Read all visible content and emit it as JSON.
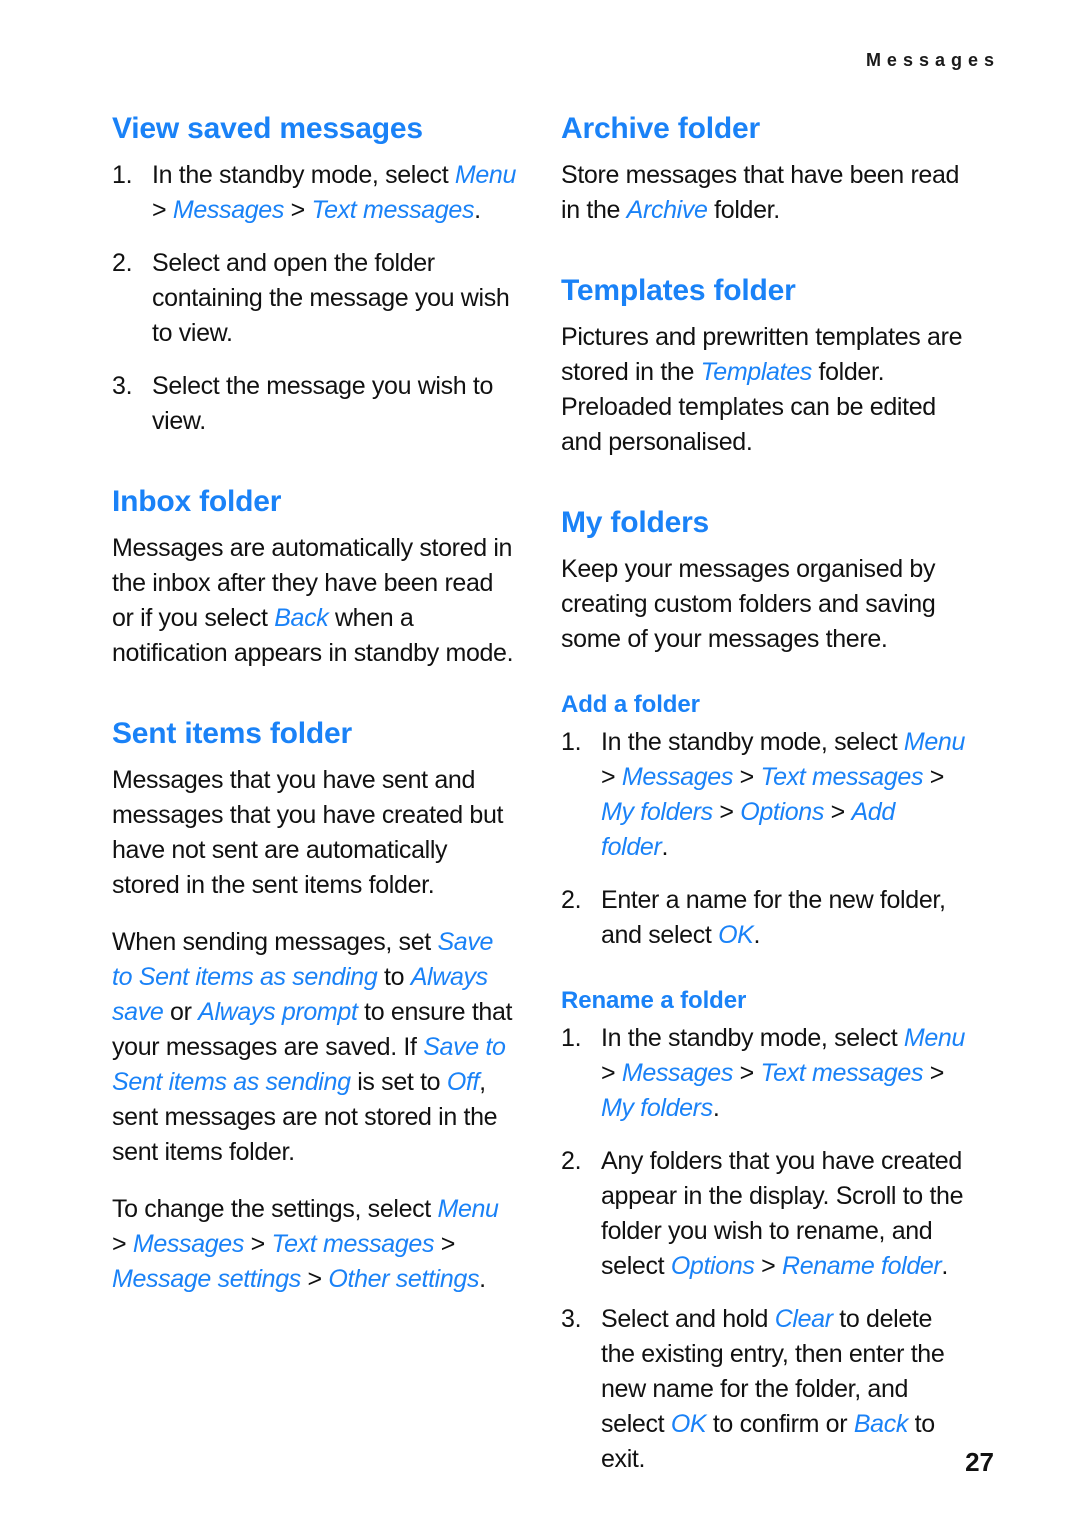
{
  "page": {
    "running_header": "Messages",
    "folio": "27",
    "accent_color": "#1a82f7",
    "text_color": "#111111",
    "background": "#ffffff"
  },
  "left_column": {
    "sections": [
      {
        "heading": "View saved messages",
        "level": 1,
        "steps": [
          {
            "number": "1.",
            "parts": [
              {
                "type": "text",
                "value": "In the standby mode, select "
              },
              {
                "type": "ui",
                "value": "Menu"
              },
              {
                "type": "sep",
                "value": " > "
              },
              {
                "type": "ui",
                "value": "Messages"
              },
              {
                "type": "sep",
                "value": " > "
              },
              {
                "type": "ui",
                "value": "Text messages"
              },
              {
                "type": "text",
                "value": "."
              }
            ]
          },
          {
            "number": "2.",
            "parts": [
              {
                "type": "text",
                "value": "Select and open the folder containing the message you wish to view."
              }
            ]
          },
          {
            "number": "3.",
            "parts": [
              {
                "type": "text",
                "value": "Select the message you wish to view."
              }
            ]
          }
        ]
      },
      {
        "heading": "Inbox folder",
        "level": 1,
        "paragraphs": [
          [
            {
              "type": "text",
              "value": "Messages are automatically stored in the inbox after they have been read or if you select "
            },
            {
              "type": "ui",
              "value": "Back"
            },
            {
              "type": "text",
              "value": " when a notification appears in standby mode."
            }
          ]
        ]
      },
      {
        "heading": "Sent items folder",
        "level": 1,
        "paragraphs": [
          [
            {
              "type": "text",
              "value": "Messages that you have sent and messages that you have created but have not sent are automatically stored in the sent items folder."
            }
          ],
          [
            {
              "type": "text",
              "value": "When sending messages, set "
            },
            {
              "type": "ui",
              "value": "Save to Sent items as sending"
            },
            {
              "type": "text",
              "value": " to "
            },
            {
              "type": "ui",
              "value": "Always save"
            },
            {
              "type": "text",
              "value": " or "
            },
            {
              "type": "ui",
              "value": "Always prompt"
            },
            {
              "type": "text",
              "value": " to ensure that your messages are saved. If "
            },
            {
              "type": "ui",
              "value": "Save to Sent items as sending"
            },
            {
              "type": "text",
              "value": " is set to "
            },
            {
              "type": "ui",
              "value": "Off"
            },
            {
              "type": "text",
              "value": ", sent messages are not stored in the sent items folder."
            }
          ],
          [
            {
              "type": "text",
              "value": "To change the settings, select "
            },
            {
              "type": "ui",
              "value": "Menu"
            },
            {
              "type": "sep",
              "value": " > "
            },
            {
              "type": "ui",
              "value": "Messages"
            },
            {
              "type": "sep",
              "value": " > "
            },
            {
              "type": "ui",
              "value": "Text messages"
            },
            {
              "type": "sep",
              "value": " > "
            },
            {
              "type": "ui",
              "value": "Message settings"
            },
            {
              "type": "sep",
              "value": " > "
            },
            {
              "type": "ui",
              "value": "Other settings"
            },
            {
              "type": "text",
              "value": "."
            }
          ]
        ]
      }
    ]
  },
  "right_column": {
    "sections": [
      {
        "heading": "Archive folder",
        "level": 1,
        "paragraphs": [
          [
            {
              "type": "text",
              "value": "Store messages that have been read in the "
            },
            {
              "type": "ui",
              "value": "Archive"
            },
            {
              "type": "text",
              "value": " folder."
            }
          ]
        ]
      },
      {
        "heading": "Templates folder",
        "level": 1,
        "paragraphs": [
          [
            {
              "type": "text",
              "value": "Pictures and prewritten templates are stored in the "
            },
            {
              "type": "ui",
              "value": "Templates"
            },
            {
              "type": "text",
              "value": " folder. Preloaded templates can be edited and personalised."
            }
          ]
        ]
      },
      {
        "heading": "My folders",
        "level": 1,
        "paragraphs": [
          [
            {
              "type": "text",
              "value": "Keep your messages organised by creating custom folders and saving some of your messages there."
            }
          ]
        ]
      },
      {
        "heading": "Add a folder",
        "level": 2,
        "steps": [
          {
            "number": "1.",
            "parts": [
              {
                "type": "text",
                "value": "In the standby mode, select "
              },
              {
                "type": "ui",
                "value": "Menu"
              },
              {
                "type": "sep",
                "value": " > "
              },
              {
                "type": "ui",
                "value": "Messages"
              },
              {
                "type": "sep",
                "value": " > "
              },
              {
                "type": "ui",
                "value": "Text messages"
              },
              {
                "type": "sep",
                "value": " > "
              },
              {
                "type": "ui",
                "value": "My folders"
              },
              {
                "type": "sep",
                "value": " > "
              },
              {
                "type": "ui",
                "value": "Options"
              },
              {
                "type": "sep",
                "value": " > "
              },
              {
                "type": "ui",
                "value": "Add folder"
              },
              {
                "type": "text",
                "value": "."
              }
            ]
          },
          {
            "number": "2.",
            "parts": [
              {
                "type": "text",
                "value": "Enter a name for the new folder, and select "
              },
              {
                "type": "ui",
                "value": "OK"
              },
              {
                "type": "text",
                "value": "."
              }
            ]
          }
        ]
      },
      {
        "heading": "Rename a folder",
        "level": 2,
        "steps": [
          {
            "number": "1.",
            "parts": [
              {
                "type": "text",
                "value": "In the standby mode, select "
              },
              {
                "type": "ui",
                "value": "Menu"
              },
              {
                "type": "sep",
                "value": " > "
              },
              {
                "type": "ui",
                "value": "Messages"
              },
              {
                "type": "sep",
                "value": " > "
              },
              {
                "type": "ui",
                "value": "Text messages"
              },
              {
                "type": "sep",
                "value": " > "
              },
              {
                "type": "ui",
                "value": "My folders"
              },
              {
                "type": "text",
                "value": "."
              }
            ]
          },
          {
            "number": "2.",
            "parts": [
              {
                "type": "text",
                "value": "Any folders that you have created appear in the display. Scroll to the folder you wish to rename, and select "
              },
              {
                "type": "ui",
                "value": "Options"
              },
              {
                "type": "sep",
                "value": " > "
              },
              {
                "type": "ui",
                "value": "Rename folder"
              },
              {
                "type": "text",
                "value": "."
              }
            ]
          },
          {
            "number": "3.",
            "parts": [
              {
                "type": "text",
                "value": "Select and hold "
              },
              {
                "type": "ui",
                "value": "Clear"
              },
              {
                "type": "text",
                "value": " to delete the existing entry, then enter the new name for the folder, and select "
              },
              {
                "type": "ui",
                "value": "OK"
              },
              {
                "type": "text",
                "value": " to confirm or "
              },
              {
                "type": "ui",
                "value": "Back"
              },
              {
                "type": "text",
                "value": " to exit."
              }
            ]
          }
        ]
      }
    ]
  }
}
